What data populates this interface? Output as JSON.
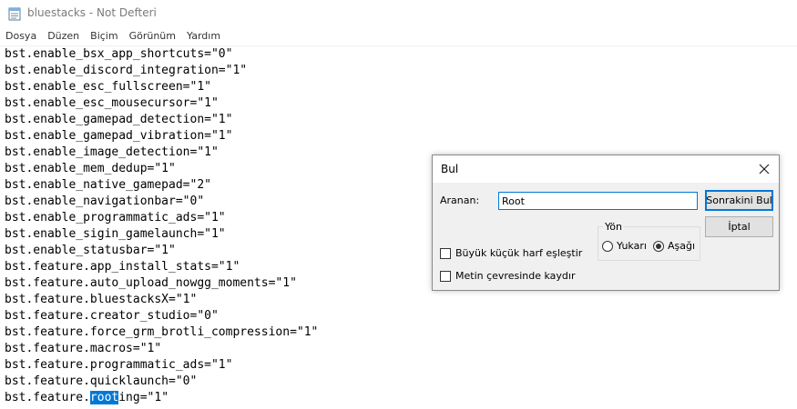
{
  "window": {
    "title": "bluestacks - Not Defteri",
    "icon": "notepad-icon"
  },
  "menu": [
    "Dosya",
    "Düzen",
    "Biçim",
    "Görünüm",
    "Yardım"
  ],
  "editor": {
    "lines": [
      "bst.enable_bsx_app_shortcuts=\"0\"",
      "bst.enable_discord_integration=\"1\"",
      "bst.enable_esc_fullscreen=\"1\"",
      "bst.enable_esc_mousecursor=\"1\"",
      "bst.enable_gamepad_detection=\"1\"",
      "bst.enable_gamepad_vibration=\"1\"",
      "bst.enable_image_detection=\"1\"",
      "bst.enable_mem_dedup=\"1\"",
      "bst.enable_native_gamepad=\"2\"",
      "bst.enable_navigationbar=\"0\"",
      "bst.enable_programmatic_ads=\"1\"",
      "bst.enable_sigin_gamelaunch=\"1\"",
      "bst.enable_statusbar=\"1\"",
      "bst.feature.app_install_stats=\"1\"",
      "bst.feature.auto_upload_nowgg_moments=\"1\"",
      "bst.feature.bluestacksX=\"1\"",
      "bst.feature.creator_studio=\"0\"",
      "bst.feature.force_grm_brotli_compression=\"1\"",
      "bst.feature.macros=\"1\"",
      "bst.feature.programmatic_ads=\"1\"",
      "bst.feature.quicklaunch=\"0\""
    ],
    "last_line": {
      "before": "bst.feature.",
      "highlight": "root",
      "after": "ing=\"1\""
    }
  },
  "find_dialog": {
    "title": "Bul",
    "find_label": "Aranan:",
    "find_value": "Root",
    "find_next": "Sonrakini Bul",
    "cancel": "İptal",
    "direction_label": "Yön",
    "up": "Yukarı",
    "down": "Aşağı",
    "selected_direction": "down",
    "match_case": "Büyük küçük harf eşleştir",
    "match_case_checked": false,
    "wrap_around": "Metin çevresinde kaydır",
    "wrap_around_checked": false
  },
  "colors": {
    "selection": "#0078d7",
    "dialog_bg": "#f0f0f0"
  }
}
